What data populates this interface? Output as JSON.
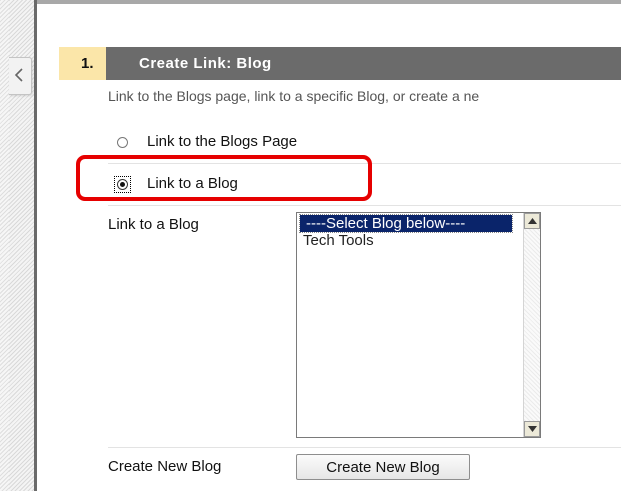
{
  "step": {
    "number": "1.",
    "title": "Create Link: Blog"
  },
  "instructions": "Link to the Blogs page, link to a specific Blog, or create a ne",
  "options": [
    {
      "label": "Link to the Blogs Page",
      "selected": false
    },
    {
      "label": "Link to a Blog",
      "selected": true
    }
  ],
  "blog_select": {
    "label": "Link to a Blog",
    "items": [
      "----Select Blog below----",
      "Tech Tools"
    ],
    "selected_index": 0
  },
  "create_new": {
    "label": "Create New Blog",
    "button_label": "Create New Blog"
  },
  "colors": {
    "header_bg": "#6b6b6b",
    "step_number_bg": "#fbe6a9",
    "highlight": "#e60000",
    "selection": "#0a246a"
  }
}
